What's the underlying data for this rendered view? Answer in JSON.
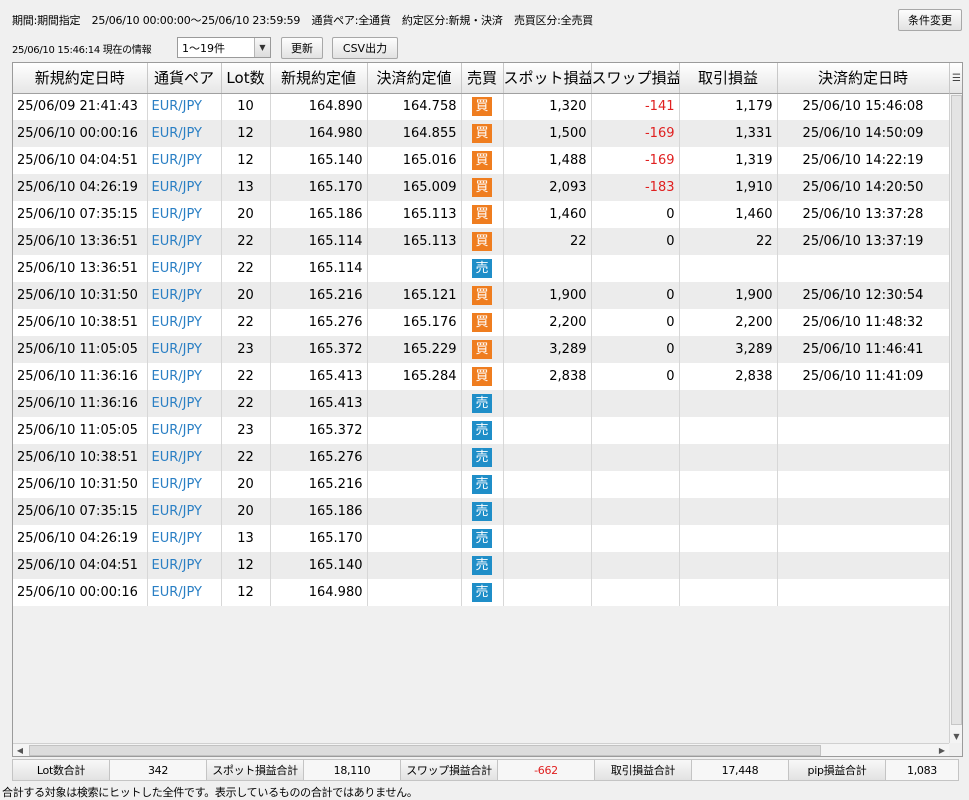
{
  "filters": {
    "period": "期間:期間指定",
    "date_range": "25/06/10 00:00:00〜25/06/10 23:59:59",
    "pair": "通貨ペア:全通貨",
    "order_type": "約定区分:新規・決済",
    "side": "売買区分:全売買"
  },
  "toolbar": {
    "change_conditions_label": "条件変更",
    "as_of": "25/06/10 15:46:14 現在の情報",
    "range_select_value": "1〜19件",
    "refresh_label": "更新",
    "csv_label": "CSV出力"
  },
  "icons": {
    "select_arrow": "chevron-down-icon",
    "column_menu": "column-menu-icon"
  },
  "colors": {
    "buy_badge": "#ef7d1f",
    "sell_badge": "#1f8ec8",
    "negative": "#e02020",
    "pair_link": "#2a7fc4"
  },
  "table": {
    "headers": [
      "新規約定日時",
      "通貨ペア",
      "Lot数",
      "新規約定値",
      "決済約定値",
      "売買",
      "スポット損益",
      "スワップ損益",
      "取引損益",
      "決済約定日時"
    ],
    "rows": [
      [
        "25/06/09 21:41:43",
        "EUR/JPY",
        "10",
        "164.890",
        "164.758",
        "買",
        "1,320",
        "-141",
        "1,179",
        "25/06/10 15:46:08"
      ],
      [
        "25/06/10 00:00:16",
        "EUR/JPY",
        "12",
        "164.980",
        "164.855",
        "買",
        "1,500",
        "-169",
        "1,331",
        "25/06/10 14:50:09"
      ],
      [
        "25/06/10 04:04:51",
        "EUR/JPY",
        "12",
        "165.140",
        "165.016",
        "買",
        "1,488",
        "-169",
        "1,319",
        "25/06/10 14:22:19"
      ],
      [
        "25/06/10 04:26:19",
        "EUR/JPY",
        "13",
        "165.170",
        "165.009",
        "買",
        "2,093",
        "-183",
        "1,910",
        "25/06/10 14:20:50"
      ],
      [
        "25/06/10 07:35:15",
        "EUR/JPY",
        "20",
        "165.186",
        "165.113",
        "買",
        "1,460",
        "0",
        "1,460",
        "25/06/10 13:37:28"
      ],
      [
        "25/06/10 13:36:51",
        "EUR/JPY",
        "22",
        "165.114",
        "165.113",
        "買",
        "22",
        "0",
        "22",
        "25/06/10 13:37:19"
      ],
      [
        "25/06/10 13:36:51",
        "EUR/JPY",
        "22",
        "165.114",
        "",
        "売",
        "",
        "",
        "",
        ""
      ],
      [
        "25/06/10 10:31:50",
        "EUR/JPY",
        "20",
        "165.216",
        "165.121",
        "買",
        "1,900",
        "0",
        "1,900",
        "25/06/10 12:30:54"
      ],
      [
        "25/06/10 10:38:51",
        "EUR/JPY",
        "22",
        "165.276",
        "165.176",
        "買",
        "2,200",
        "0",
        "2,200",
        "25/06/10 11:48:32"
      ],
      [
        "25/06/10 11:05:05",
        "EUR/JPY",
        "23",
        "165.372",
        "165.229",
        "買",
        "3,289",
        "0",
        "3,289",
        "25/06/10 11:46:41"
      ],
      [
        "25/06/10 11:36:16",
        "EUR/JPY",
        "22",
        "165.413",
        "165.284",
        "買",
        "2,838",
        "0",
        "2,838",
        "25/06/10 11:41:09"
      ],
      [
        "25/06/10 11:36:16",
        "EUR/JPY",
        "22",
        "165.413",
        "",
        "売",
        "",
        "",
        "",
        ""
      ],
      [
        "25/06/10 11:05:05",
        "EUR/JPY",
        "23",
        "165.372",
        "",
        "売",
        "",
        "",
        "",
        ""
      ],
      [
        "25/06/10 10:38:51",
        "EUR/JPY",
        "22",
        "165.276",
        "",
        "売",
        "",
        "",
        "",
        ""
      ],
      [
        "25/06/10 10:31:50",
        "EUR/JPY",
        "20",
        "165.216",
        "",
        "売",
        "",
        "",
        "",
        ""
      ],
      [
        "25/06/10 07:35:15",
        "EUR/JPY",
        "20",
        "165.186",
        "",
        "売",
        "",
        "",
        "",
        ""
      ],
      [
        "25/06/10 04:26:19",
        "EUR/JPY",
        "13",
        "165.170",
        "",
        "売",
        "",
        "",
        "",
        ""
      ],
      [
        "25/06/10 04:04:51",
        "EUR/JPY",
        "12",
        "165.140",
        "",
        "売",
        "",
        "",
        "",
        ""
      ],
      [
        "25/06/10 00:00:16",
        "EUR/JPY",
        "12",
        "164.980",
        "",
        "売",
        "",
        "",
        "",
        ""
      ]
    ]
  },
  "totals": {
    "lot_label": "Lot数合計",
    "lot_value": "342",
    "spot_label": "スポット損益合計",
    "spot_value": "18,110",
    "swap_label": "スワップ損益合計",
    "swap_value": "-662",
    "trade_label": "取引損益合計",
    "trade_value": "17,448",
    "pip_label": "pip損益合計",
    "pip_value": "1,083"
  },
  "footer_note": "合計する対象は検索にヒットした全件です。表示しているものの合計ではありません。"
}
